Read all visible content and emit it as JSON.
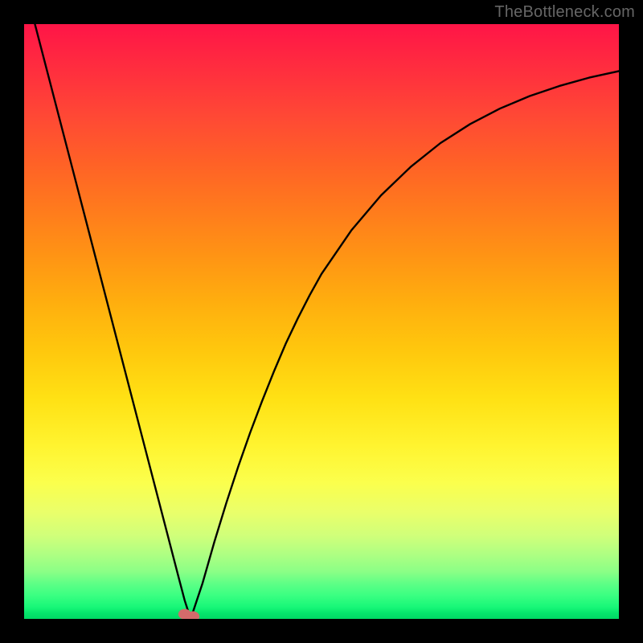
{
  "watermark": {
    "text": "TheBottleneck.com"
  },
  "colors": {
    "curve_stroke": "#000000",
    "marker_fill": "#d36b6b",
    "frame_bg": "#000000"
  },
  "chart_data": {
    "type": "line",
    "title": "",
    "xlabel": "",
    "ylabel": "",
    "xlim": [
      0,
      100
    ],
    "ylim": [
      0,
      100
    ],
    "grid": false,
    "legend": false,
    "series": [
      {
        "name": "bottleneck-curve",
        "x": [
          0,
          2,
          4,
          6,
          8,
          10,
          12,
          14,
          16,
          18,
          20,
          22,
          24,
          26,
          27,
          28,
          30,
          32,
          34,
          36,
          38,
          40,
          42,
          44,
          46,
          48,
          50,
          55,
          60,
          65,
          70,
          75,
          80,
          85,
          90,
          95,
          100
        ],
        "values": [
          107,
          99.3,
          91.6,
          83.9,
          76.2,
          68.5,
          60.8,
          53.1,
          45.4,
          37.7,
          30.0,
          22.3,
          14.6,
          6.9,
          3.1,
          0.0,
          6.0,
          13.0,
          19.5,
          25.6,
          31.3,
          36.6,
          41.6,
          46.3,
          50.5,
          54.4,
          58.0,
          65.3,
          71.2,
          76.0,
          80.0,
          83.2,
          85.8,
          87.9,
          89.6,
          91.0,
          92.1
        ]
      }
    ],
    "markers": [
      {
        "name": "optimum-point",
        "x": 27.0,
        "y": 0.8,
        "color": "#d36b6b"
      },
      {
        "name": "optimum-point-shadow",
        "x": 28.4,
        "y": 0.4,
        "color": "#d36b6b"
      }
    ]
  }
}
